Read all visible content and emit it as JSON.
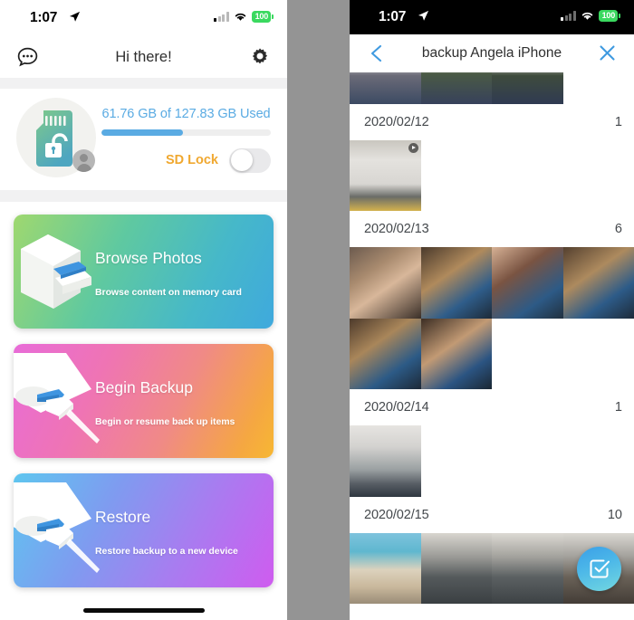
{
  "left_phone": {
    "status_bar": {
      "time": "1:07",
      "battery": "100",
      "location_icon": "location-arrow-icon",
      "wifi_icon": "wifi-icon",
      "signal_icon": "cellular-signal-icon"
    },
    "nav_bar": {
      "title": "Hi there!",
      "chat_icon": "chat-bubble-icon",
      "settings_icon": "gear-icon"
    },
    "storage": {
      "sd_icon": "sd-card-unlocked-icon",
      "avatar_icon": "user-avatar-icon",
      "used_text": "61.76 GB of 127.83 GB Used",
      "used_gb": "61.76",
      "total_gb": "127.83",
      "percent": 48,
      "bar_color": "#5aabe3",
      "sd_lock_label": "SD Lock",
      "sd_lock_color": "#f0a830",
      "sd_lock_on": false
    },
    "cards": [
      {
        "title": "Browse Photos",
        "subtitle": "Browse content on memory card",
        "art_icon": "card-reader-icon",
        "class": "c1"
      },
      {
        "title": "Begin Backup",
        "subtitle": "Begin or resume back up items",
        "art_icon": "lightning-cable-icon",
        "class": "c2"
      },
      {
        "title": "Restore",
        "subtitle": "Restore backup to a new device",
        "art_icon": "lightning-cable-icon",
        "class": "c3"
      }
    ],
    "home_indicator": "home-indicator"
  },
  "right_phone": {
    "status_bar": {
      "time": "1:07",
      "battery": "100"
    },
    "nav_bar": {
      "title": "backup Angela iPhone",
      "back_icon": "chevron-left-icon",
      "close_icon": "close-x-icon"
    },
    "sections": [
      {
        "date": "",
        "count": "",
        "partial_top": true,
        "photos": 3
      },
      {
        "date": "2020/02/12",
        "count": "1",
        "photos": 1
      },
      {
        "date": "2020/02/13",
        "count": "6",
        "photos": 6
      },
      {
        "date": "2020/02/14",
        "count": "1",
        "photos": 1
      },
      {
        "date": "2020/02/15",
        "count": "10",
        "photos": 4
      }
    ],
    "fab": {
      "icon": "check-square-icon",
      "color": "#4db8e8"
    }
  }
}
